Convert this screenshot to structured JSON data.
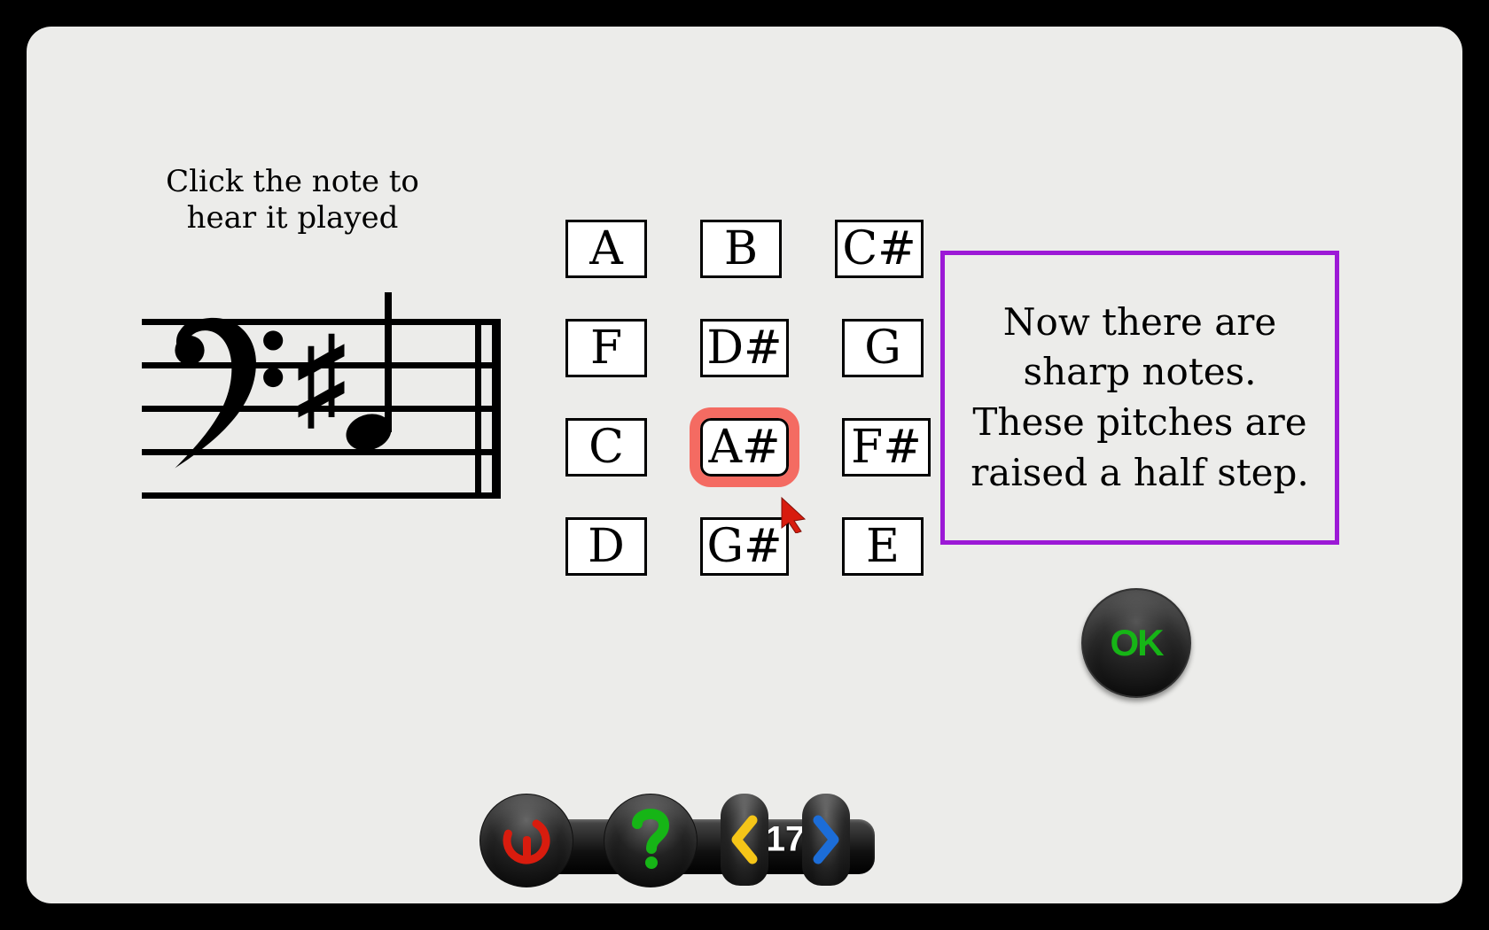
{
  "instruction": "Click the note to hear it played",
  "staff": {
    "clef": "bass",
    "accidental": "sharp",
    "line_position": "middle"
  },
  "note_grid": [
    [
      "A",
      "B",
      "C#"
    ],
    [
      "F",
      "D#",
      "G"
    ],
    [
      "C",
      "A#",
      "F#"
    ],
    [
      "D",
      "G#",
      "E"
    ]
  ],
  "selected_note": "A#",
  "info_text": "Now there are sharp notes. These pitches are raised a half step.",
  "ok_label": "OK",
  "level": "17"
}
